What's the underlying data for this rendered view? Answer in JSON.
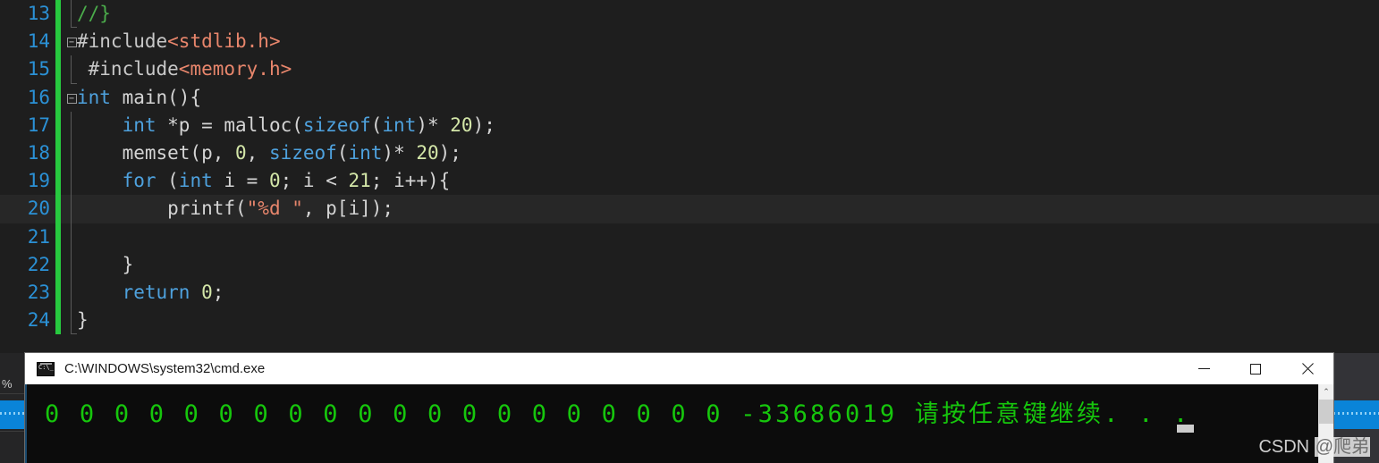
{
  "editor": {
    "name": "code-editor",
    "language": "c",
    "first_line_number": 13,
    "current_line": 20,
    "lines": [
      {
        "number": "13",
        "fold": "",
        "guide": "end",
        "tokens": [
          {
            "text": "//}",
            "cls": "t-cmt"
          }
        ]
      },
      {
        "number": "14",
        "fold": "minus",
        "guide": "none",
        "tokens": [
          {
            "text": "#include",
            "cls": "t-pp"
          },
          {
            "text": "<stdlib.h>",
            "cls": "t-hdr"
          }
        ]
      },
      {
        "number": "15",
        "fold": "",
        "guide": "end",
        "tokens": [
          {
            "text": " #include",
            "cls": "t-pp"
          },
          {
            "text": "<memory.h>",
            "cls": "t-hdr"
          }
        ]
      },
      {
        "number": "16",
        "fold": "minus",
        "guide": "none",
        "tokens": [
          {
            "text": "int",
            "cls": "t-kw"
          },
          {
            "text": " main(){",
            "cls": "t-plain"
          }
        ]
      },
      {
        "number": "17",
        "fold": "",
        "guide": "line",
        "tokens": [
          {
            "text": "    ",
            "cls": "t-plain"
          },
          {
            "text": "int",
            "cls": "t-kw"
          },
          {
            "text": " *p = malloc(",
            "cls": "t-plain"
          },
          {
            "text": "sizeof",
            "cls": "t-kw"
          },
          {
            "text": "(",
            "cls": "t-plain"
          },
          {
            "text": "int",
            "cls": "t-kw"
          },
          {
            "text": ")* ",
            "cls": "t-plain"
          },
          {
            "text": "20",
            "cls": "t-num"
          },
          {
            "text": ");",
            "cls": "t-plain"
          }
        ]
      },
      {
        "number": "18",
        "fold": "",
        "guide": "line",
        "tokens": [
          {
            "text": "    memset(p, ",
            "cls": "t-plain"
          },
          {
            "text": "0",
            "cls": "t-num"
          },
          {
            "text": ", ",
            "cls": "t-plain"
          },
          {
            "text": "sizeof",
            "cls": "t-kw"
          },
          {
            "text": "(",
            "cls": "t-plain"
          },
          {
            "text": "int",
            "cls": "t-kw"
          },
          {
            "text": ")* ",
            "cls": "t-plain"
          },
          {
            "text": "20",
            "cls": "t-num"
          },
          {
            "text": ");",
            "cls": "t-plain"
          }
        ]
      },
      {
        "number": "19",
        "fold": "",
        "guide": "line",
        "tokens": [
          {
            "text": "    ",
            "cls": "t-plain"
          },
          {
            "text": "for",
            "cls": "t-kw"
          },
          {
            "text": " (",
            "cls": "t-plain"
          },
          {
            "text": "int",
            "cls": "t-kw"
          },
          {
            "text": " i = ",
            "cls": "t-plain"
          },
          {
            "text": "0",
            "cls": "t-num"
          },
          {
            "text": "; i < ",
            "cls": "t-plain"
          },
          {
            "text": "21",
            "cls": "t-num"
          },
          {
            "text": "; i++){",
            "cls": "t-plain"
          }
        ]
      },
      {
        "number": "20",
        "fold": "",
        "guide": "line",
        "current": true,
        "tokens": [
          {
            "text": "        printf(",
            "cls": "t-plain"
          },
          {
            "text": "\"%d \"",
            "cls": "t-str"
          },
          {
            "text": ", p[i]);",
            "cls": "t-plain"
          }
        ]
      },
      {
        "number": "21",
        "fold": "",
        "guide": "line",
        "tokens": [
          {
            "text": "",
            "cls": "t-plain"
          }
        ]
      },
      {
        "number": "22",
        "fold": "",
        "guide": "line",
        "tokens": [
          {
            "text": "    }",
            "cls": "t-plain"
          }
        ]
      },
      {
        "number": "23",
        "fold": "",
        "guide": "line",
        "tokens": [
          {
            "text": "    ",
            "cls": "t-plain"
          },
          {
            "text": "return",
            "cls": "t-kw"
          },
          {
            "text": " ",
            "cls": "t-plain"
          },
          {
            "text": "0",
            "cls": "t-num"
          },
          {
            "text": ";",
            "cls": "t-plain"
          }
        ]
      },
      {
        "number": "24",
        "fold": "",
        "guide": "end",
        "tokens": [
          {
            "text": "}",
            "cls": "t-plain"
          }
        ]
      }
    ]
  },
  "background": {
    "percent_label": "%"
  },
  "console": {
    "title": "C:\\WINDOWS\\system32\\cmd.exe",
    "icon": "cmd-icon",
    "buttons": {
      "minimize": "minimize",
      "maximize": "maximize",
      "close": "close"
    },
    "output": "0 0 0 0 0 0 0 0 0 0 0 0 0 0 0 0 0 0 0 0 -33686019 请按任意键继续. . .",
    "output_values": [
      "0",
      "0",
      "0",
      "0",
      "0",
      "0",
      "0",
      "0",
      "0",
      "0",
      "0",
      "0",
      "0",
      "0",
      "0",
      "0",
      "0",
      "0",
      "0",
      "0",
      "-33686019"
    ],
    "prompt_text": "请按任意键继续. . .",
    "text_color": "#16c60c",
    "background_color": "#0c0c0c",
    "scrollbar": {
      "up_arrow": "⌃"
    }
  },
  "watermark": {
    "brand": "CSDN",
    "handle": "@爬弟"
  }
}
